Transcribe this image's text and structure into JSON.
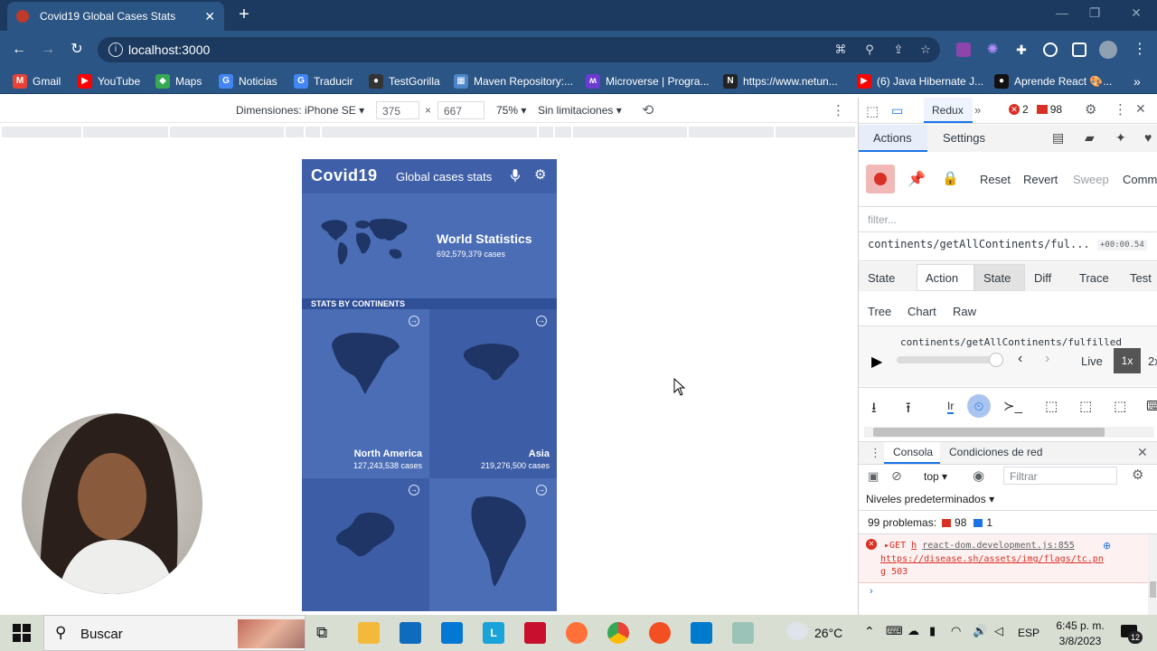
{
  "browser": {
    "tab_title": "Covid19 Global Cases Stats",
    "new_tab": "+",
    "close_tab": "✕",
    "url": "localhost:3000",
    "bookmarks": [
      {
        "label": "Gmail",
        "color": "#ea4335"
      },
      {
        "label": "YouTube",
        "color": "#ff0000"
      },
      {
        "label": "Maps",
        "color": "#34a853"
      },
      {
        "label": "Noticias",
        "color": "#4285f4"
      },
      {
        "label": "Traducir",
        "color": "#4285f4"
      },
      {
        "label": "TestGorilla",
        "color": "#333333"
      },
      {
        "label": "Maven Repository:...",
        "color": "#4a86c8"
      },
      {
        "label": "Microverse | Progra...",
        "color": "#6c3bd1"
      },
      {
        "label": "https://www.netun...",
        "color": "#222222"
      },
      {
        "label": "(6) Java Hibernate J...",
        "color": "#ff0000"
      },
      {
        "label": "Aprende React 🎨...",
        "color": "#111111"
      }
    ]
  },
  "device_toolbar": {
    "device": "Dimensiones: iPhone SE",
    "width": "375",
    "times": "×",
    "height": "667",
    "zoom": "75%",
    "throttle": "Sin limitaciones"
  },
  "app": {
    "name": "Covid19",
    "subtitle": "Global cases stats",
    "world_title": "World Statistics",
    "world_cases": "692,579,379 cases",
    "section_label": "STATS BY CONTINENTS",
    "continents": [
      {
        "name": "North America",
        "cases": "127,243,538 cases"
      },
      {
        "name": "Asia",
        "cases": "219,276,500 cases"
      },
      {
        "name": "",
        "cases": ""
      },
      {
        "name": "",
        "cases": ""
      }
    ],
    "colors": {
      "header": "#3f60a8",
      "tile_light": "#4a6db5",
      "tile_dark": "#3d5ea6",
      "bar": "#2f4f97"
    }
  },
  "devtools": {
    "tab_redux": "Redux",
    "error_count": "2",
    "warn_count": "98",
    "subtabs": [
      "Actions",
      "Settings"
    ],
    "buttons": [
      "Reset",
      "Revert",
      "Sweep",
      "Comm"
    ],
    "filter_placeholder": "filter...",
    "action_name": "continents/getAllContinents/ful...",
    "action_time": "+00:00.54",
    "inspector_tabs": [
      "State",
      "Action",
      "State",
      "Diff",
      "Trace",
      "Test"
    ],
    "view_tabs": [
      "Tree",
      "Chart",
      "Raw"
    ],
    "slider_label": "continents/getAllContinents/fulfilled",
    "live": "Live",
    "speed": "1x",
    "speed2": "2x",
    "drawer_tabs": [
      "Consola",
      "Condiciones de red"
    ],
    "context": "top",
    "console_filter": "Filtrar",
    "levels": "Niveles predeterminados",
    "problems_label": "99 problemas:",
    "problems_errors": "98",
    "problems_info": "1",
    "error_method": "GET",
    "error_h": "h",
    "error_source": "react-dom.development.js:855",
    "error_url": "https://disease.sh/assets/img/flags/tc.pn",
    "error_url2": "g",
    "error_status": "503"
  },
  "taskbar": {
    "search": "Buscar",
    "temperature": "26°C",
    "lang": "ESP",
    "time": "6:45 p. m.",
    "date": "3/8/2023",
    "notifications": "12"
  }
}
